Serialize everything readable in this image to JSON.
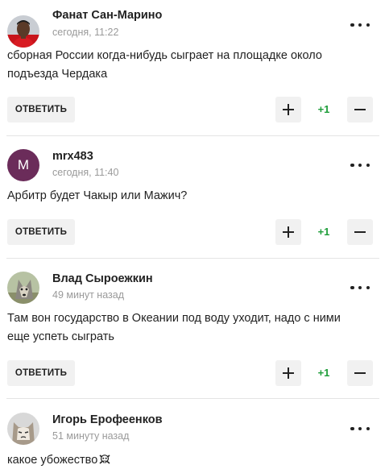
{
  "comments": [
    {
      "author": "Фанат Сан-Марино",
      "time": "сегодня, 11:22",
      "avatar": "player-photo-avatar",
      "text_lines": [
        "сборная России когда-нибудь сыграет на площадке около",
        "подъезда Чердака"
      ],
      "reply_label": "ОТВЕТИТЬ",
      "score": "+1"
    },
    {
      "author": "mrx483",
      "time": "сегодня, 11:40",
      "avatar_letter": "M",
      "avatar_color": "#6b2c5a",
      "text_lines": [
        "Арбитр будет Чакыр или Мажич?"
      ],
      "reply_label": "ОТВЕТИТЬ",
      "score": "+1"
    },
    {
      "author": "Влад Сыроежкин",
      "time": "49 минут назад",
      "avatar": "wolf-photo-avatar",
      "text_lines": [
        "Там вон государство в Океании под воду уходит, надо с ними",
        "еще успеть сыграть"
      ],
      "reply_label": "ОТВЕТИТЬ",
      "score": "+1"
    },
    {
      "author": "Игорь Ерофеенков",
      "time": "51 минуту назад",
      "avatar": "grumpy-cat-avatar",
      "text_lines": [
        "какое убожество"
      ],
      "emoji": "skull-crossbones-icon"
    }
  ],
  "colors": {
    "score_green": "#1f9e3a",
    "button_bg": "#f1f1f1",
    "divider": "#e4e4e4",
    "time_gray": "#9a9a9a"
  },
  "icons": {
    "upvote": "plus-icon",
    "downvote": "minus-icon",
    "more": "more-dots-icon"
  }
}
